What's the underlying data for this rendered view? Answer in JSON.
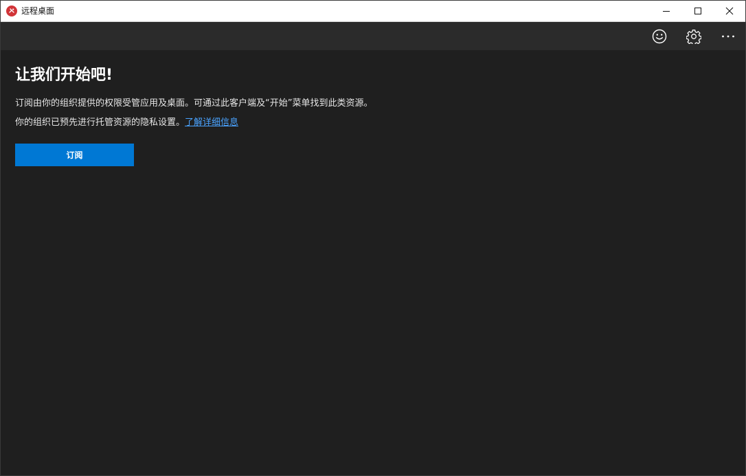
{
  "window": {
    "title": "远程桌面"
  },
  "icons": {
    "app": "remote-desktop-icon",
    "minimize": "minimize-icon",
    "maximize": "maximize-icon",
    "close": "close-icon",
    "feedback": "smiley-icon",
    "settings": "gear-icon",
    "more": "more-dots-icon"
  },
  "colors": {
    "accent": "#0078d4",
    "link": "#4aa3ff",
    "app_icon": "#d13438",
    "background": "#1f1f1f",
    "toolbar": "#2b2b2b"
  },
  "main": {
    "title": "让我们开始吧!",
    "description_line1": "订阅由你的组织提供的权限受管应用及桌面。可通过此客户端及“开始”菜单找到此类资源。",
    "description_line2": "你的组织已预先进行托管资源的隐私设置。",
    "learn_more_link": "了解详细信息",
    "subscribe_button": "订阅"
  }
}
